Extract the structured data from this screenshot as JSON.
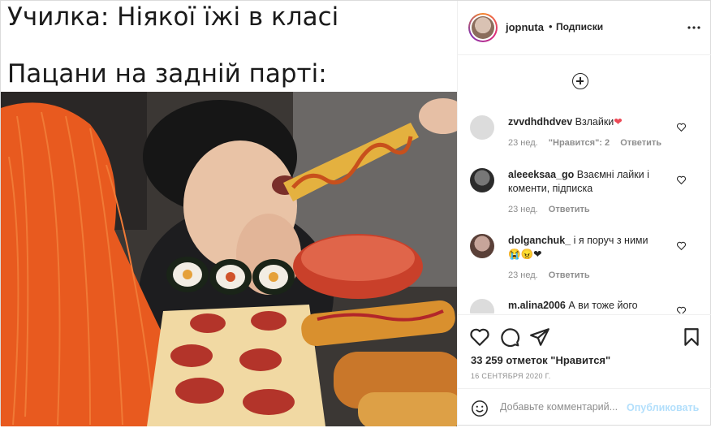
{
  "meme": {
    "line1": "Училка: Ніякої їжі в класі",
    "line2": "Пацани на задній парті:"
  },
  "header": {
    "username": "jopnuta",
    "dot": "•",
    "follow_label": "Подписки",
    "more_icon": "more-horizontal-icon"
  },
  "load_more_icon": "plus-circle-icon",
  "comments": [
    {
      "user": "zvvdhdhdvev",
      "text": "Взлайки",
      "emoji": "❤",
      "time": "23 нед.",
      "likes": "\"Нравится\": 2",
      "reply": "Ответить"
    },
    {
      "user": "aleeeksaa_go",
      "text": "Взаємні лайки і коменти, підписка",
      "emoji": "",
      "time": "23 нед.",
      "likes": "",
      "reply": "Ответить"
    },
    {
      "user": "dolganchuk_",
      "text": "і я поруч з ними",
      "emoji": "😭😠❤",
      "time": "23 нед.",
      "likes": "",
      "reply": "Ответить"
    },
    {
      "user": "m.alina2006",
      "text": "А ви тоже його",
      "emoji": "",
      "time": "",
      "likes": "",
      "reply": ""
    }
  ],
  "actions": {
    "like_icon": "heart-icon",
    "comment_icon": "comment-icon",
    "share_icon": "paper-plane-icon",
    "save_icon": "bookmark-icon",
    "likes_text": "33 259 отметок \"Нравится\"",
    "date": "16 СЕНТЯБРЯ 2020 Г."
  },
  "add_comment": {
    "emoji_icon": "smiley-icon",
    "placeholder": "Добавьте комментарий...",
    "publish_label": "Опубликовать"
  },
  "colors": {
    "accent": "#0095f6",
    "publish_disabled": "#b2dffc",
    "heart": "#ed4956",
    "muted": "#8e8e8e"
  }
}
